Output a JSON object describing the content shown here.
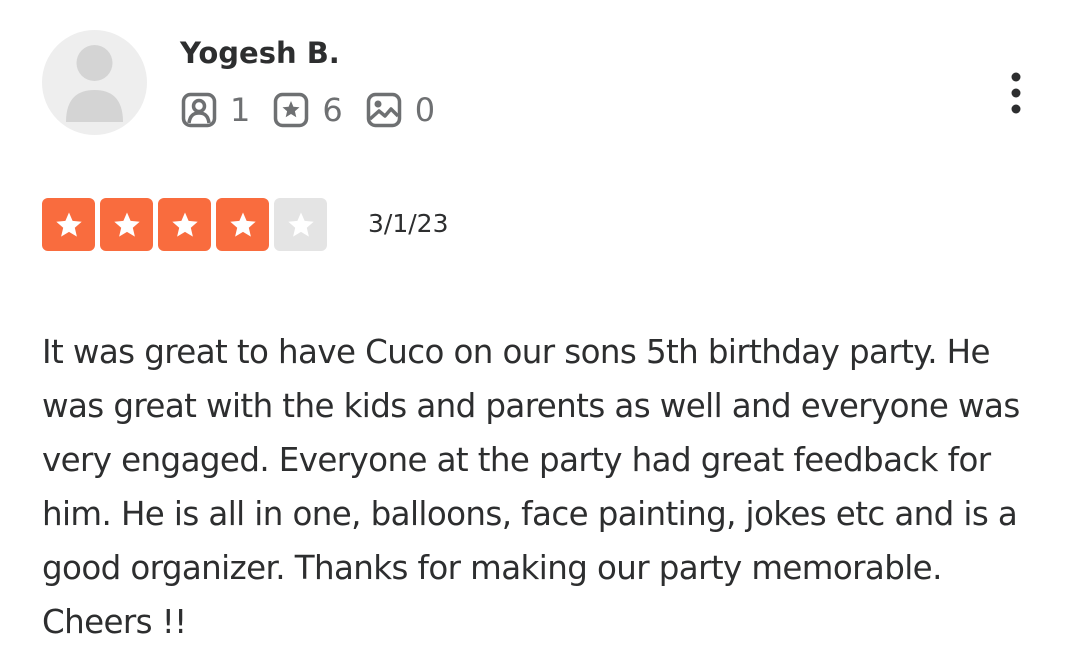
{
  "user": {
    "name": "Yogesh B.",
    "avatar_icon": "default-user-avatar-icon",
    "stats": [
      {
        "icon": "friends-icon",
        "count": "1"
      },
      {
        "icon": "reviews-star-icon",
        "count": "6"
      },
      {
        "icon": "photos-icon",
        "count": "0"
      }
    ]
  },
  "menu_icon": "more-vertical-icon",
  "rating": {
    "value": 4,
    "max": 5,
    "filled_color": "#f96c3e",
    "empty_color": "#e4e4e4",
    "star_color": "#ffffff"
  },
  "review": {
    "date": "3/1/23",
    "text": "It was great to have Cuco on our sons 5th birthday party. He was great with the kids and parents as well and everyone was very engaged. Everyone at the party had great feedback for him. He is all in one, balloons, face painting, jokes etc and is a good organizer. Thanks for making our party memorable. Cheers !!"
  }
}
